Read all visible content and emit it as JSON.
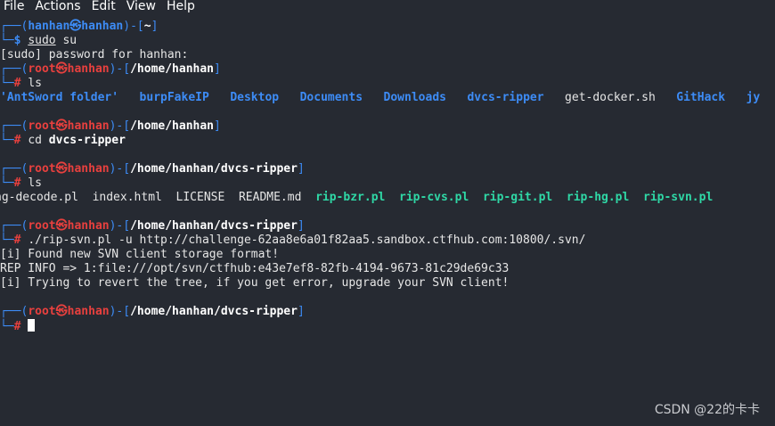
{
  "menu": [
    "File",
    "Actions",
    "Edit",
    "View",
    "Help"
  ],
  "prompt": {
    "box_top": "┌──(",
    "box_bottom": "└─",
    "close_paren": ")-[",
    "close_bracket": "]",
    "user_hanhan": "hanhan",
    "host": "hanhan",
    "user_root": "root",
    "at": "㉿",
    "dollar": "$",
    "hash": "#"
  },
  "paths": {
    "home": "~",
    "home_hanhan": "/home/hanhan",
    "dvcs": "/home/hanhan/dvcs-ripper"
  },
  "commands": {
    "sudo": "sudo",
    "su": " su",
    "ls": "ls",
    "cd": "cd ",
    "cd_arg": "dvcs-ripper",
    "rip": "./rip-svn.pl -u http://challenge-62aa8e6a01f82aa5.sandbox.ctfhub.com:10800/.svn/"
  },
  "sudo_prompt": "[sudo] password for hanhan:",
  "ls1": [
    "'AntSword folder'",
    "burpFakeIP",
    "Desktop",
    "Documents",
    "Downloads",
    "dvcs-ripper",
    "get-docker.sh",
    "GitHack",
    "jy"
  ],
  "ls2": [
    "hg-decode.pl",
    "index.html",
    "LICENSE",
    "README.md",
    "rip-bzr.pl",
    "rip-cvs.pl",
    "rip-git.pl",
    "rip-hg.pl",
    "rip-svn.pl"
  ],
  "output": [
    "[i] Found new SVN client storage format!",
    "REP INFO => 1:file:///opt/svn/ctfhub:e43e7ef8-82fb-4194-9673-81c29de69c33",
    "[i] Trying to revert the tree, if you get error, upgrade your SVN client!"
  ],
  "watermark": "CSDN @22的卡卡"
}
